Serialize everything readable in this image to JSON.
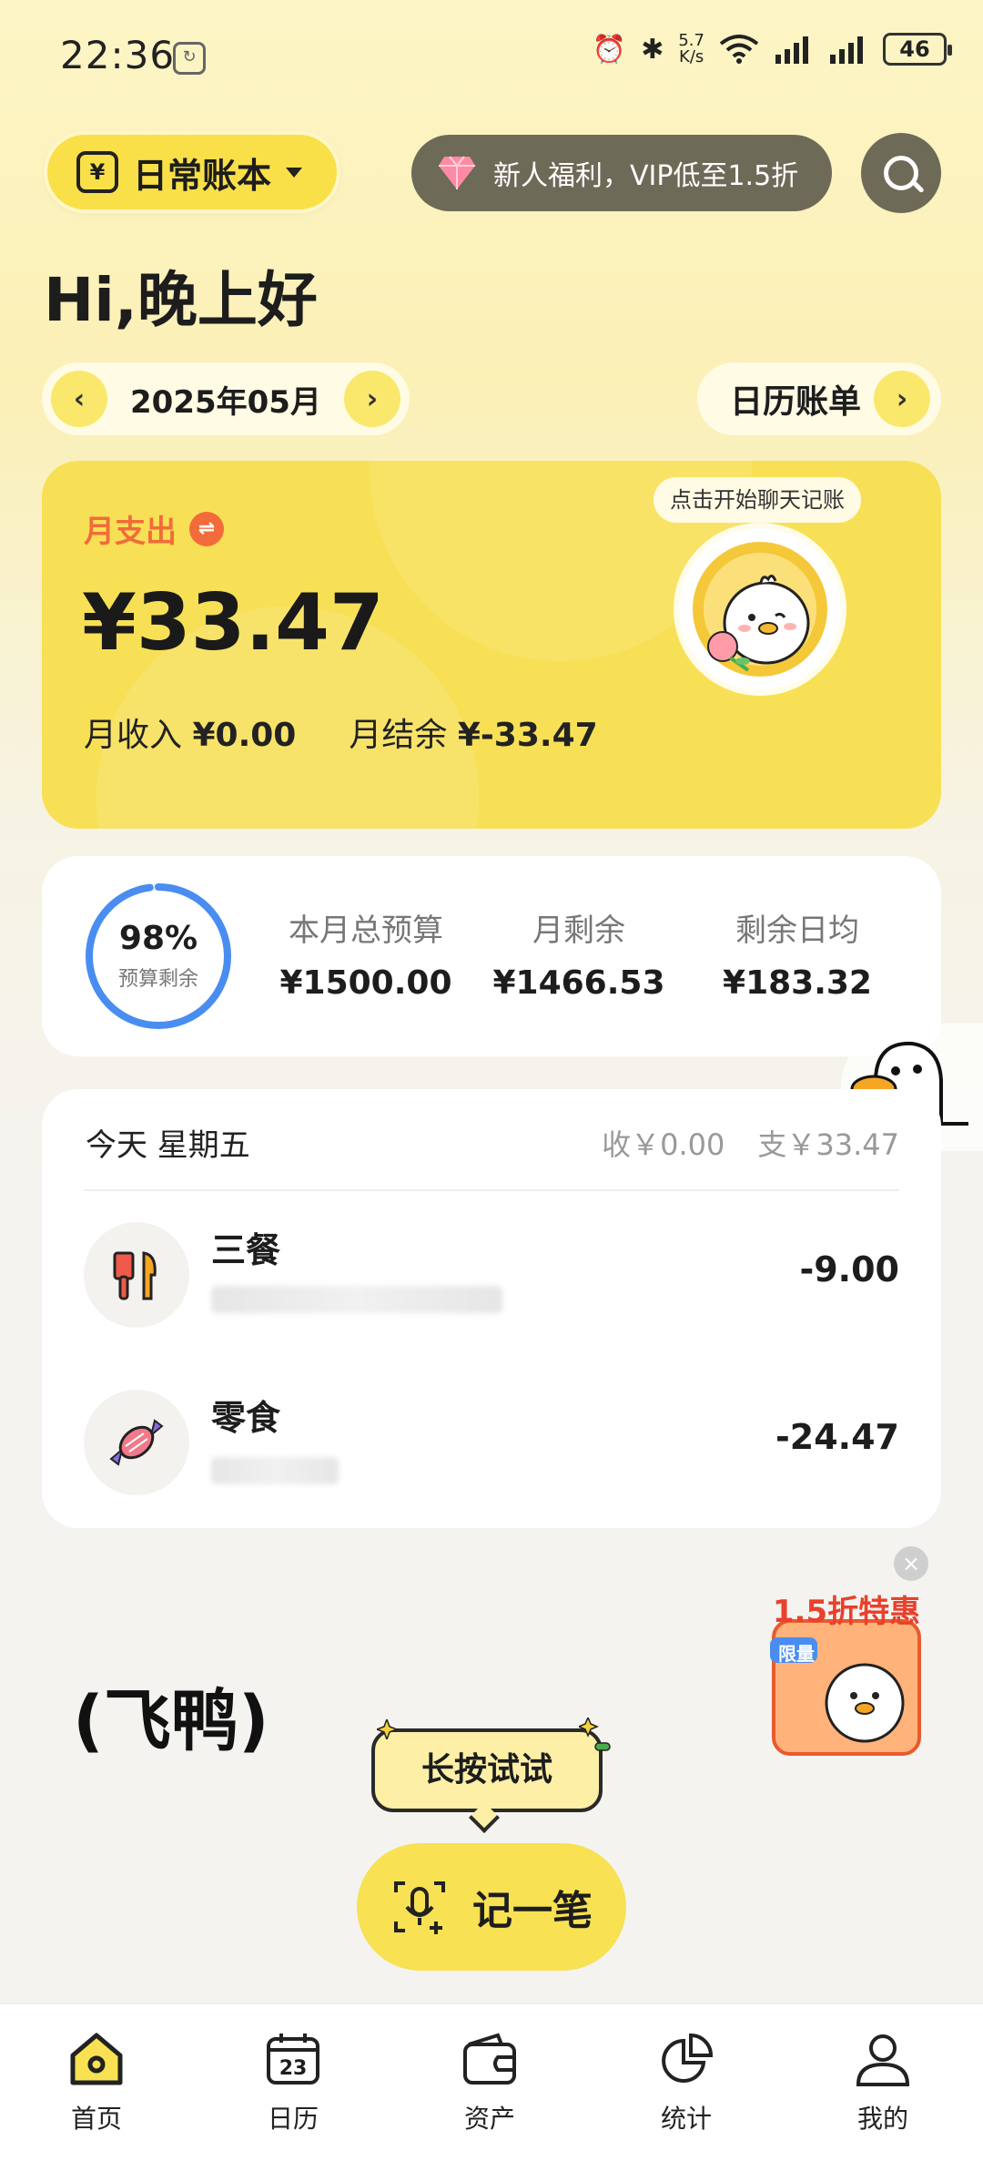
{
  "status_bar": {
    "time": "22:36",
    "net_speed_value": "5.7",
    "net_speed_unit": "K/s",
    "battery": "46"
  },
  "header": {
    "book_icon_glyph": "¥",
    "book_label": "日常账本",
    "promo_text": "新人福利，VIP低至1.5折"
  },
  "greeting": "Hi,晚上好",
  "month": {
    "current": "2025年05月",
    "prev_icon": "chevron-left-icon",
    "next_icon": "chevron-right-icon"
  },
  "calendar_bill_label": "日历账单",
  "expense_card": {
    "label": "月支出",
    "amount": "¥33.47",
    "income_label": "月收入",
    "income_value": "¥0.00",
    "balance_label": "月结余",
    "balance_value": "¥-33.47",
    "chat_tip": "点击开始聊天记账"
  },
  "budget": {
    "percent_text": "98%",
    "percent_value": 0.98,
    "percent_label": "预算剩余",
    "items": [
      {
        "label": "本月总预算",
        "value": "¥1500.00"
      },
      {
        "label": "月剩余",
        "value": "¥1466.53"
      },
      {
        "label": "剩余日均",
        "value": "¥183.32"
      }
    ]
  },
  "today": {
    "title": "今天 星期五",
    "income": "收￥0.00",
    "expense": "支￥33.47",
    "rows": [
      {
        "title": "三餐",
        "amount": "-9.00",
        "icon": "utensils-icon"
      },
      {
        "title": "零食",
        "amount": "-24.47",
        "icon": "candy-icon"
      }
    ]
  },
  "bottom": {
    "brand_text": "(飞鸭)",
    "tip_bubble": "长按试试",
    "record_button": "记一笔",
    "promo_badge_title": "1.5折特惠",
    "promo_badge_sub": "限量",
    "close_glyph": "×"
  },
  "tabs": [
    {
      "label": "首页",
      "icon": "home-icon"
    },
    {
      "label": "日历",
      "icon": "calendar-icon",
      "badge": "23"
    },
    {
      "label": "资产",
      "icon": "wallet-icon"
    },
    {
      "label": "统计",
      "icon": "pie-chart-icon"
    },
    {
      "label": "我的",
      "icon": "user-icon"
    }
  ],
  "colors": {
    "accent_yellow": "#f8e056",
    "expense_orange": "#f26b3a",
    "ring_blue": "#4a8df0",
    "dark_pill": "#6e6a58"
  }
}
